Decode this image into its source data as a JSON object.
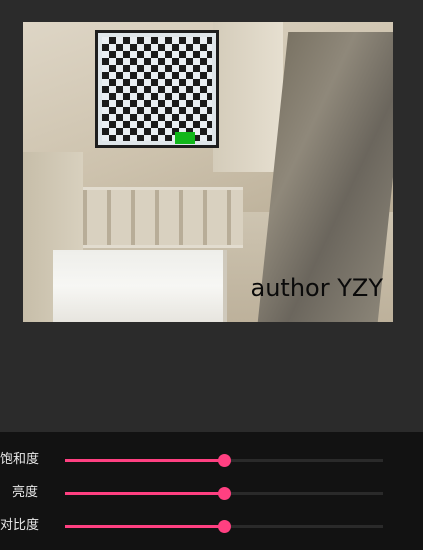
{
  "preview": {
    "watermark": "author YZY"
  },
  "adjustments": [
    {
      "label": "饱和度",
      "value": 0.5
    },
    {
      "label": "亮度",
      "value": 0.5
    },
    {
      "label": "对比度",
      "value": 0.5
    }
  ],
  "colors": {
    "accent": "#ff4081",
    "panel_background": "#121212",
    "app_background": "#2b2b2b",
    "marker_green": "#11b71a"
  }
}
